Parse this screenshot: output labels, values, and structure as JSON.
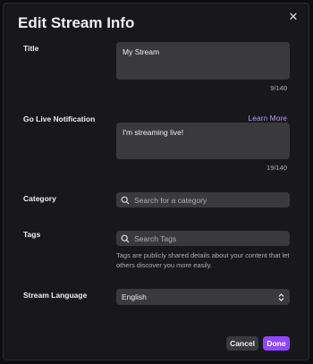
{
  "dialog": {
    "title": "Edit Stream Info",
    "close_icon": "close-icon"
  },
  "fields": {
    "title": {
      "label": "Title",
      "value": "My Stream",
      "counter": "9/140"
    },
    "go_live": {
      "label": "Go Live Notification",
      "link": "Learn More",
      "value": "I'm streaming live!",
      "counter": "19/140"
    },
    "category": {
      "label": "Category",
      "placeholder": "Search for a category",
      "icon": "search-icon"
    },
    "tags": {
      "label": "Tags",
      "placeholder": "Search Tags",
      "icon": "search-icon",
      "helper": "Tags are publicly shared details about your content that let others discover you more easily."
    },
    "language": {
      "label": "Stream Language",
      "value": "English",
      "icon": "chevron-updown-icon"
    }
  },
  "actions": {
    "cancel": "Cancel",
    "done": "Done"
  },
  "colors": {
    "background": "#18181b",
    "input": "#3a3a3d",
    "accent": "#9147ff",
    "link": "#bf94ff",
    "muted": "#adadb8"
  }
}
